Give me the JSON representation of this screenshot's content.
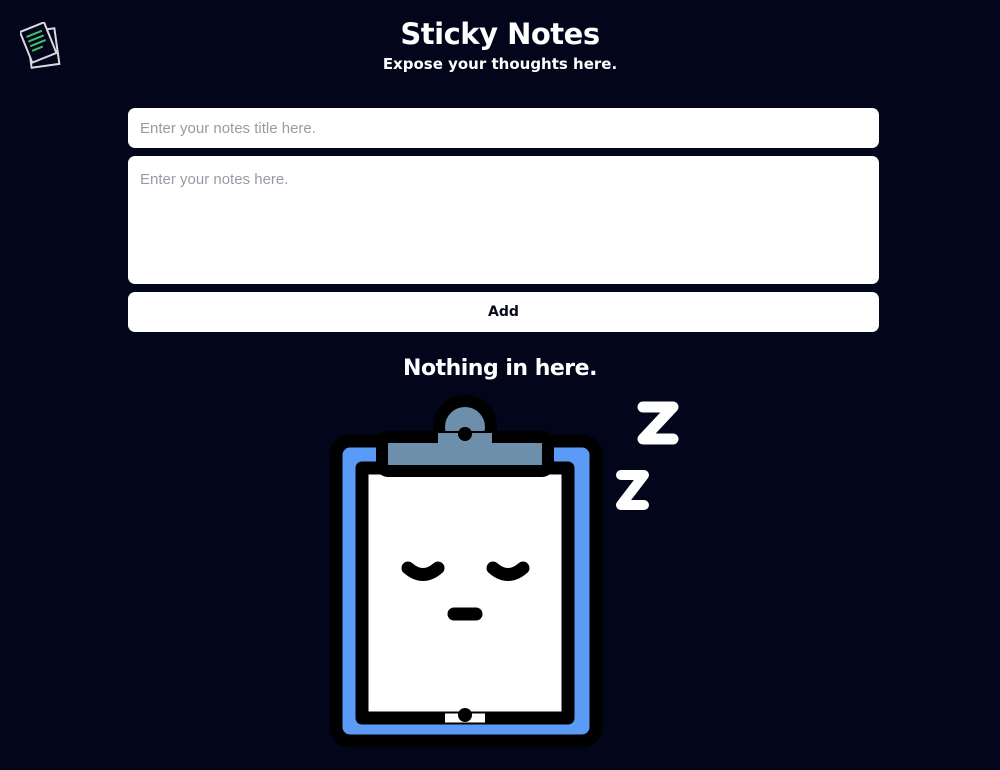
{
  "app": {
    "title": "Sticky Notes",
    "subtitle": "Expose your thoughts here."
  },
  "form": {
    "title_placeholder": "Enter your notes title here.",
    "title_value": "",
    "notes_placeholder": "Enter your notes here.",
    "notes_value": "",
    "add_label": "Add"
  },
  "empty_state": {
    "message": "Nothing in here.",
    "icon": "sleeping-clipboard-icon"
  },
  "icons": {
    "logo": "notes-logo-icon"
  },
  "colors": {
    "background": "#03061a",
    "clipboard_blue": "#5b9bf8",
    "clip_gray": "#6e8fab",
    "note_accent": "#3fbf6b"
  }
}
